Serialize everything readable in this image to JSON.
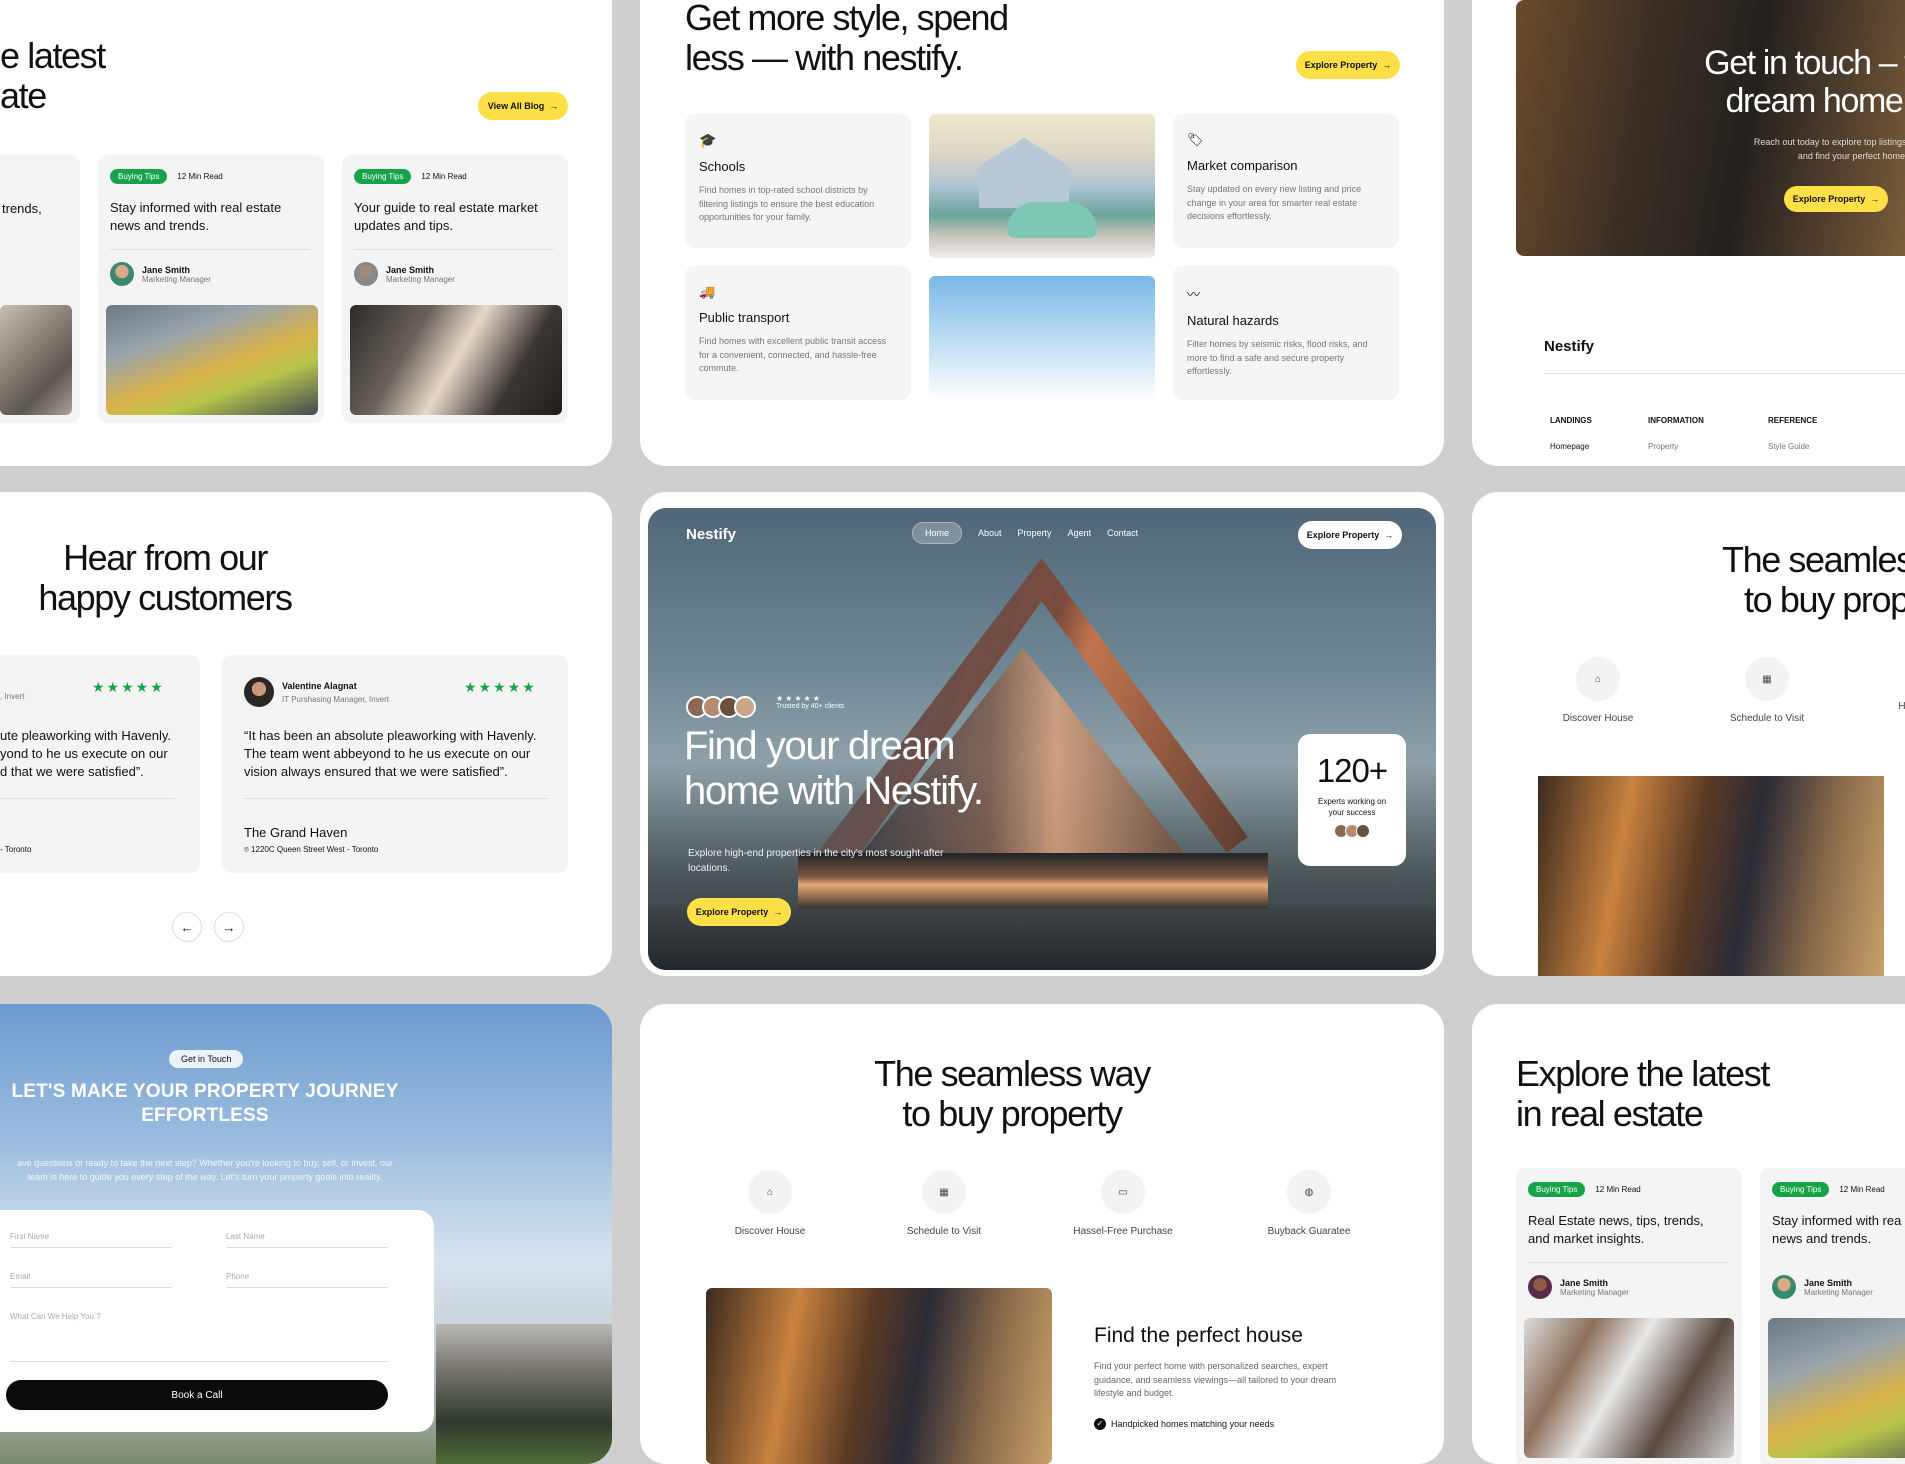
{
  "blog_top": {
    "title_line1": "e latest",
    "title_line2": "ate",
    "view_all": "View All Blog",
    "partial_text": "trends,",
    "cards": [
      {
        "tag": "Buying Tips",
        "read": "12 Min Read",
        "title": "Stay informed with real estate news and trends.",
        "author": "Jane Smith",
        "role": "Marketing Manager"
      },
      {
        "tag": "Buying Tips",
        "read": "12 Min Read",
        "title": "Your guide to real estate market updates and tips.",
        "author": "Jane Smith",
        "role": "Marketing Manager"
      }
    ]
  },
  "features": {
    "title_line1": "Get more style, spend",
    "title_line2": "less — with nestify.",
    "cta": "Explore Property",
    "items": [
      {
        "icon": "graduation-cap-icon",
        "title": "Schools",
        "desc": "Find homes in top-rated school districts by filtering listings to ensure the best education opportunities for your family."
      },
      {
        "icon": "truck-icon",
        "title": "Public transport",
        "desc": "Find homes with excellent public transit access for a convenient, connected, and hassle-free commute."
      },
      {
        "icon": "tag-icon",
        "title": "Market comparison",
        "desc": "Stay updated on every new listing and price change in your area for smarter real estate decisions effortlessly."
      },
      {
        "icon": "activity-icon",
        "title": "Natural hazards",
        "desc": "Filter homes by seismic risks, flood risks, and more to find a safe and secure property effortlessly."
      }
    ]
  },
  "contact_top": {
    "title_line1": "Get in touch – fin",
    "title_line2": "dream home to",
    "sub_line1": "Reach out today to explore top listings, get ex",
    "sub_line2": "and find your perfect home with ea",
    "cta": "Explore Property",
    "footer_brand": "Nestify",
    "cols": [
      {
        "head": "LANDINGS",
        "link": "Homepage"
      },
      {
        "head": "INFORMATION",
        "link": "Property"
      },
      {
        "head": "REFERENCE",
        "link": "Style Guide"
      }
    ]
  },
  "testimonials": {
    "title_line1": "Hear from our",
    "title_line2": "happy customers",
    "left": {
      "role": ", Invert",
      "quote_l1": "ute pleaworking with Havenly.",
      "quote_l2": "yond to he us execute on our",
      "quote_l3": "d that we were satisfied”.",
      "addr": "- Toronto"
    },
    "right": {
      "name": "Valentine Alagnat",
      "role": "IT Purshasing Manager, Invert",
      "quote": "“It has been an absolute pleaworking with Havenly. The team went abbeyond to he us execute on our vision always ensured that we were satisfied”.",
      "place": "The Grand Haven",
      "addr": "1220C Queen Street West - Toronto"
    },
    "stars": "★★★★★"
  },
  "hero": {
    "brand": "Nestify",
    "nav": [
      "Home",
      "About",
      "Property",
      "Agent",
      "Contact"
    ],
    "cta_top": "Explore Property",
    "trusted": "Trusted by 40+ clients",
    "stars": "★★★★★",
    "title_line1": "Find your dream",
    "title_line2": "home with Nestify.",
    "sub": "Explore high-end properties in the city's most sought-after locations.",
    "cta": "Explore Property",
    "stat_value": "120+",
    "stat_label": "Experts working on your success"
  },
  "seamless_top": {
    "title_line1": "The seamles",
    "title_line2": "to buy prop",
    "steps": [
      "Discover House",
      "Schedule to Visit",
      "H"
    ]
  },
  "contact_form": {
    "badge": "Get in Touch",
    "title_line1": "LET'S MAKE YOUR PROPERTY JOURNEY",
    "title_line2": "EFFORTLESS",
    "sub_line1": "ave questions or ready to take the next step? Whether you're looking to buy, sell, or invest, our",
    "sub_line2": "team is here to guide you every step of the way. Let's turn your property goals into reality.",
    "first_name": "First Name",
    "last_name": "Last Name",
    "email": "Email",
    "phone": "Phone",
    "message": "What Can We Help You ?",
    "submit": "Book a Call"
  },
  "seamless": {
    "title_line1": "The seamless way",
    "title_line2": "to buy property",
    "steps": [
      {
        "icon": "home-icon",
        "label": "Discover House"
      },
      {
        "icon": "calendar-icon",
        "label": "Schedule to Visit"
      },
      {
        "icon": "wallet-icon",
        "label": "Hassel-Free Purchase"
      },
      {
        "icon": "shield-icon",
        "label": "Buyback Guaratee"
      }
    ],
    "find_title": "Find the perfect house",
    "find_desc": "Find your perfect home with personalized searches, expert guidance, and seamless viewings—all tailored to your dream lifestyle and budget.",
    "bullet": "Handpicked homes matching your needs"
  },
  "explore": {
    "title_line1": "Explore the latest",
    "title_line2": "in real estate",
    "cards": [
      {
        "tag": "Buying Tips",
        "read": "12 Min Read",
        "title": "Real Estate news, tips, trends, and market insights.",
        "author": "Jane Smith",
        "role": "Marketing Manager"
      },
      {
        "tag": "Buying Tips",
        "read": "12 Min Read",
        "title": "Stay informed with rea news and trends.",
        "author": "Jane Smith",
        "role": "Marketing Manager"
      }
    ]
  }
}
